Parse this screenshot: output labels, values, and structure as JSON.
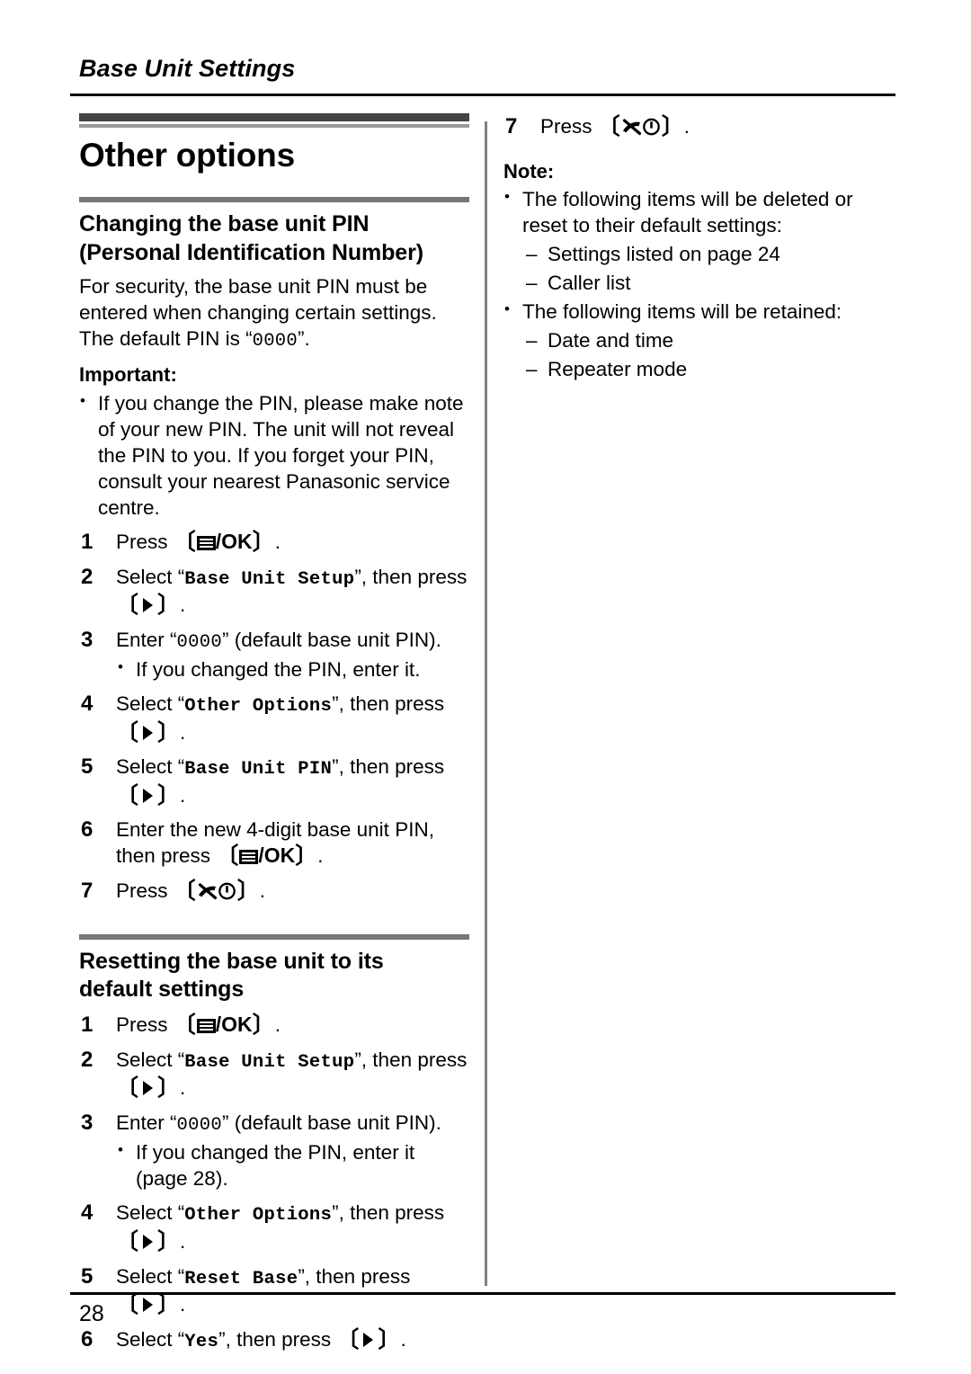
{
  "header": {
    "title": "Base Unit Settings"
  },
  "chapter": {
    "title": "Other options"
  },
  "sections": [
    {
      "title_line1": "Changing the base unit PIN",
      "title_line2": "(Personal Identification Number)",
      "intro": "For security, the base unit PIN must be entered when changing certain settings. The default PIN is “0000”.",
      "intro_parts": {
        "before": "For security, the base unit PIN must be entered when changing certain settings. The default PIN is “",
        "mono": "0000",
        "after": "”."
      },
      "important_label": "Important:",
      "important_bullets": [
        "If you change the PIN, please make note of your new PIN. The unit will not reveal the PIN to you. If you forget your PIN, consult your nearest Panasonic service centre."
      ],
      "steps": [
        {
          "num": "1",
          "before": "Press ",
          "key": "menu-ok",
          "after": "."
        },
        {
          "num": "2",
          "before": "Select “",
          "mono": "Base Unit Setup",
          "mid": "”, then press ",
          "key": "right-arrow",
          "after": "."
        },
        {
          "num": "3",
          "before": "Enter “",
          "mono": "0000",
          "after": "” (default base unit PIN).",
          "substep": "If you changed the PIN, enter it."
        },
        {
          "num": "4",
          "before": "Select “",
          "mono": "Other Options",
          "mid": "”, then press ",
          "key": "right-arrow",
          "after": "."
        },
        {
          "num": "5",
          "before": "Select “",
          "mono": "Base Unit PIN",
          "mid": "”, then press ",
          "key": "right-arrow",
          "after": "."
        },
        {
          "num": "6",
          "before": "Enter the new 4-digit base unit PIN, then press ",
          "key": "menu-ok",
          "after": "."
        },
        {
          "num": "7",
          "before": "Press ",
          "key": "off-power",
          "after": "."
        }
      ]
    },
    {
      "title_line1": "Resetting the base unit to its",
      "title_line2": "default settings",
      "steps": [
        {
          "num": "1",
          "before": "Press ",
          "key": "menu-ok",
          "after": "."
        },
        {
          "num": "2",
          "before": "Select “",
          "mono": "Base Unit Setup",
          "mid": "”, then press ",
          "key": "right-arrow",
          "after": "."
        },
        {
          "num": "3",
          "before": "Enter “",
          "mono": "0000",
          "after": "” (default base unit PIN).",
          "substep": "If you changed the PIN, enter it (page 28)."
        },
        {
          "num": "4",
          "before": "Select “",
          "mono": "Other Options",
          "mid": "”, then press ",
          "key": "right-arrow",
          "after": "."
        },
        {
          "num": "5",
          "before": "Select “",
          "mono": "Reset Base",
          "mid": "”, then press ",
          "key": "right-arrow",
          "after": "."
        },
        {
          "num": "6",
          "before": "Select “",
          "mono": "Yes",
          "mid": "”, then press ",
          "key": "right-arrow",
          "after": "."
        }
      ]
    }
  ],
  "right_column": {
    "step7": {
      "num": "7",
      "before": "Press ",
      "key": "off-power",
      "after": "."
    },
    "note_label": "Note:",
    "note_bullets": [
      {
        "text": "The following items will be deleted or reset to their default settings:",
        "sub": [
          "Settings listed on page 24",
          "Caller list"
        ]
      },
      {
        "text": "The following items will be retained:",
        "sub": [
          "Date and time",
          "Repeater mode"
        ]
      }
    ]
  },
  "footer": {
    "page_number": "28"
  },
  "icons": {
    "menu_ok": "menu-ok-key-icon",
    "right_arrow": "right-arrow-key-icon",
    "off_power": "off-power-key-icon",
    "ok_label": "/OK"
  },
  "colors": {
    "text": "#000000",
    "bar_dark": "#444444",
    "bar_mid": "#777777",
    "bar_light": "#9a9a9a",
    "divider": "#808080"
  }
}
